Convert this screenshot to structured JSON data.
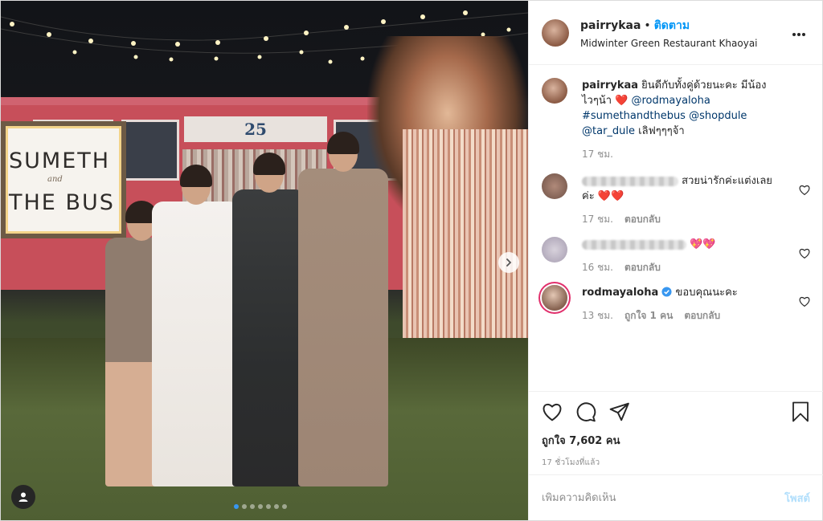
{
  "photo": {
    "bus_number": "25",
    "sign_line1": "SUMETH",
    "sign_line2": "and",
    "sign_line3": "THE BUS",
    "carousel_dots": 7,
    "active_dot": 0
  },
  "header": {
    "username": "pairrykaa",
    "separator": "•",
    "follow_label": "ติดตาม",
    "location": "Midwinter Green Restaurant Khaoyai",
    "more_icon": "more-horizontal-icon"
  },
  "caption": {
    "username": "pairrykaa",
    "text_before": "ยินดีกับทั้งคู่ด้วยนะคะ มีน้อง ไวๆน้า",
    "emoji": "❤️",
    "mention1": "@rodmayaloha",
    "hashtag": "#sumethandthebus",
    "mention2": "@shopdule",
    "mention3": "@tar_dule",
    "text_after": "เลิฟๆๆๆจ้า",
    "time": "17 ชม."
  },
  "comments": [
    {
      "text": "สวยน่ารักค่ะแต่งเลยค่ะ ❤️❤️",
      "time": "17 ชม.",
      "reply": "ตอบกลับ",
      "likes": ""
    },
    {
      "text": "💖💖",
      "time": "16 ชม.",
      "reply": "ตอบกลับ",
      "likes": ""
    },
    {
      "username": "rodmayaloha",
      "text": "ขอบคุณนะคะ",
      "time": "13 ชม.",
      "likes": "ถูกใจ 1 คน",
      "reply": "ตอบกลับ"
    }
  ],
  "actions": {
    "likes": "ถูกใจ 7,602 คน",
    "time_ago": "17 ชั่วโมงที่แล้ว"
  },
  "add_comment": {
    "placeholder": "เพิ่มความคิดเห็น",
    "post_label": "โพสต์"
  },
  "colors": {
    "accent": "#0095f6",
    "link": "#00376b",
    "verified": "#3897f0"
  }
}
